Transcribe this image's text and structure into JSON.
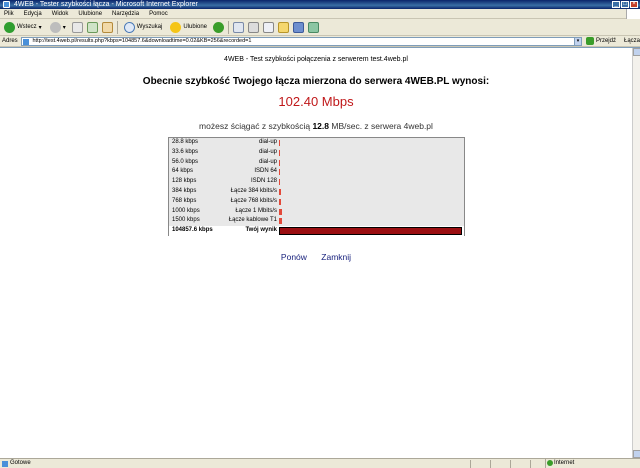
{
  "window": {
    "title": "4WEB - Tester szybkości łącza - Microsoft Internet Explorer"
  },
  "menu": [
    "Plik",
    "Edycja",
    "Widok",
    "Ulubione",
    "Narzędzia",
    "Pomoc"
  ],
  "toolbar": {
    "back_label": "Wstecz",
    "search_label": "Wyszukaj",
    "favorites_label": "Ulubione"
  },
  "address": {
    "label": "Adres",
    "url": "http://test.4web.pl/results.php?kbps=104857.6&downloadtime=0.02&KB=256&recorded=1",
    "go_label": "Przejdź",
    "links_label": "Łącza"
  },
  "page": {
    "header": "4WEB - Test szybkości połączenia z serwerem test.4web.pl",
    "heading": "Obecnie szybkość Twojego łącza mierzona do serwera 4WEB.PL wynosi:",
    "speed": "102.40 Mbps",
    "download_prefix": "możesz ściągać z szybkością",
    "download_value": "12.8",
    "download_suffix": "MB/sec. z serwera 4web.pl"
  },
  "chart_data": {
    "type": "bar",
    "orientation": "horizontal",
    "categories": [
      "28.8 kbps",
      "33.6 kbps",
      "56.0 kbps",
      "64 kbps",
      "128 kbps",
      "384 kbps",
      "768 kbps",
      "1000 kbps",
      "1500 kbps",
      "104857.6 kbps"
    ],
    "labels": [
      "dial-up",
      "dial-up",
      "dial-up",
      "ISDN 64",
      "ISDN 128",
      "Łącze 384 kbits/s",
      "Łącze 768 kbits/s",
      "Łącze 1 Mbits/s",
      "Łącze kablowe T1",
      "Twój wynik"
    ],
    "values": [
      28.8,
      33.6,
      56.0,
      64,
      128,
      384,
      768,
      1000,
      1500,
      104857.6
    ],
    "highlight_index": 9,
    "colors": {
      "bar": "#e34a3a",
      "result_bar": "#9b0f12"
    }
  },
  "actions": {
    "retry_label": "Ponów",
    "close_label": "Zamknij"
  },
  "status": {
    "left": "Gotowe",
    "zone": "Internet"
  }
}
